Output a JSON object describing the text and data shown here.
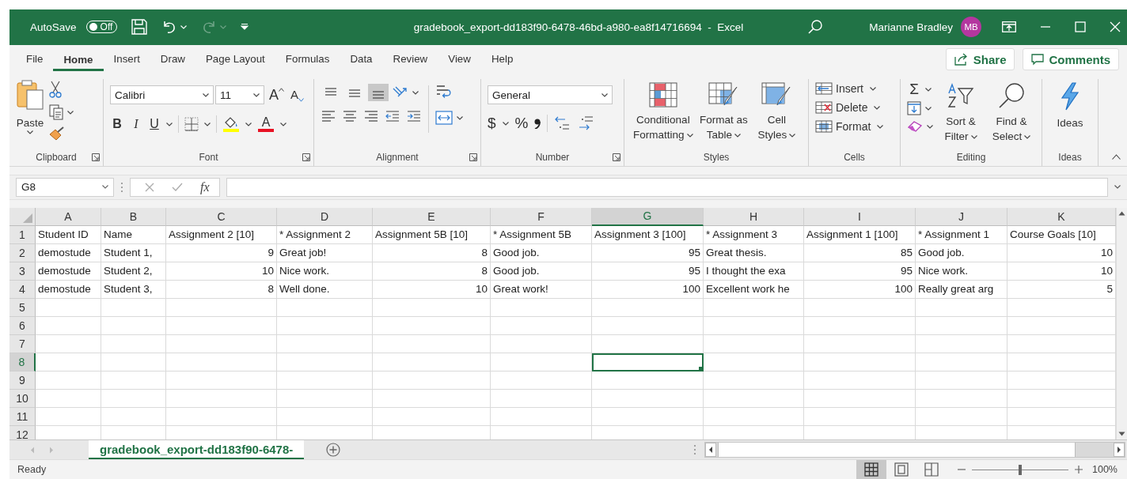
{
  "title_bar": {
    "autosave_label": "AutoSave",
    "autosave_toggle": {
      "label": "Off",
      "on": false
    },
    "quick_access": [
      {
        "kind": "save",
        "disabled": false
      },
      {
        "kind": "undo",
        "disabled": false
      },
      {
        "kind": "redo",
        "disabled": true
      },
      {
        "kind": "customize",
        "disabled": false
      }
    ],
    "title": "gradebook_export-dd183f90-6478-46bd-a980-ea8f14716694  -  Excel",
    "user_name": "Marianne Bradley",
    "avatar_initials": "MB"
  },
  "menu_tabs": [
    {
      "label": "File",
      "selected": false
    },
    {
      "label": "Home",
      "selected": true
    },
    {
      "label": "Insert",
      "selected": false
    },
    {
      "label": "Draw",
      "selected": false
    },
    {
      "label": "Page Layout",
      "selected": false
    },
    {
      "label": "Formulas",
      "selected": false
    },
    {
      "label": "Data",
      "selected": false
    },
    {
      "label": "Review",
      "selected": false
    },
    {
      "label": "View",
      "selected": false
    },
    {
      "label": "Help",
      "selected": false
    }
  ],
  "share_button": "Share",
  "comments_button": "Comments",
  "ribbon": {
    "clipboard": {
      "paste": "Paste",
      "group_label": "Clipboard"
    },
    "font": {
      "font_name": "Calibri",
      "font_size": "11",
      "grow": "A",
      "shrink": "A",
      "bold": "B",
      "italic": "I",
      "underline": "U",
      "font_color": "A",
      "group_label": "Font"
    },
    "alignment": {
      "vertical_align": [
        {
          "kind": "top",
          "selected": false
        },
        {
          "kind": "middle",
          "selected": false
        },
        {
          "kind": "bottom",
          "selected": true
        }
      ],
      "group_label": "Alignment"
    },
    "number": {
      "format": "General",
      "currency": "$",
      "percent": "%",
      "group_label": "Number"
    },
    "styles": {
      "buttons": [
        {
          "kind": "conditional",
          "label": "Conditional Formatting"
        },
        {
          "kind": "table",
          "label": "Format as Table"
        },
        {
          "kind": "cell",
          "label": "Cell Styles"
        }
      ],
      "group_label": "Styles"
    },
    "cells": {
      "buttons": [
        {
          "kind": "insert",
          "label": "Insert"
        },
        {
          "kind": "delete",
          "label": "Delete"
        },
        {
          "kind": "format",
          "label": "Format"
        }
      ],
      "group_label": "Cells"
    },
    "editing": {
      "autosum": "Σ",
      "sort_filter": "Sort & Filter",
      "find_select": "Find & Select",
      "group_label": "Editing"
    },
    "ideas": {
      "button": "Ideas",
      "group_label": "Ideas"
    }
  },
  "formula_bar": {
    "name_box": "G8",
    "function_label": "fx"
  },
  "sheet": {
    "columns": [
      {
        "label": "A",
        "kind": "text",
        "selected": false
      },
      {
        "label": "B",
        "kind": "text",
        "selected": false
      },
      {
        "label": "C",
        "kind": "number",
        "selected": false
      },
      {
        "label": "D",
        "kind": "text",
        "selected": false
      },
      {
        "label": "E",
        "kind": "number",
        "selected": false
      },
      {
        "label": "F",
        "kind": "text",
        "selected": false
      },
      {
        "label": "G",
        "kind": "number",
        "selected": true
      },
      {
        "label": "H",
        "kind": "text",
        "selected": false
      },
      {
        "label": "I",
        "kind": "number",
        "selected": false
      },
      {
        "label": "J",
        "kind": "text",
        "selected": false
      },
      {
        "label": "K",
        "kind": "number",
        "selected": false
      }
    ],
    "rows": [
      {
        "number": "1",
        "kind": "header",
        "selected": false,
        "cells": [
          "Student ID",
          "Name",
          "Assignment 2 [10]",
          "* Assignment 2",
          "Assignment 5B [10]",
          "* Assignment 5B",
          "Assignment 3 [100]",
          "* Assignment 3",
          "Assignment 1 [100]",
          "* Assignment 1",
          "Course Goals [10]"
        ]
      },
      {
        "number": "2",
        "kind": "data",
        "selected": false,
        "cells": [
          "demostude",
          "Student 1,",
          "9",
          "Great job!",
          "8",
          "Good job.",
          "95",
          "Great thesis.",
          "85",
          "Good job.",
          "10"
        ]
      },
      {
        "number": "3",
        "kind": "data",
        "selected": false,
        "cells": [
          "demostude",
          "Student 2,",
          "10",
          "Nice work.",
          "8",
          "Good job.",
          "95",
          "I thought the exa",
          "95",
          "Nice work.",
          "10"
        ]
      },
      {
        "number": "4",
        "kind": "data",
        "selected": false,
        "cells": [
          "demostude",
          "Student 3,",
          "8",
          "Well done.",
          "10",
          "Great work!",
          "100",
          "Excellent work he",
          "100",
          "Really great arg",
          "5"
        ]
      },
      {
        "number": "5",
        "kind": "empty",
        "selected": false
      },
      {
        "number": "6",
        "kind": "empty",
        "selected": false
      },
      {
        "number": "7",
        "kind": "empty",
        "selected": false
      },
      {
        "number": "8",
        "kind": "empty",
        "selected": true
      },
      {
        "number": "9",
        "kind": "empty",
        "selected": false
      },
      {
        "number": "10",
        "kind": "empty",
        "selected": false
      },
      {
        "number": "11",
        "kind": "empty",
        "selected": false
      },
      {
        "number": "12",
        "kind": "empty",
        "selected": false
      }
    ]
  },
  "sheet_tabs": [
    {
      "label": "gradebook_export-dd183f90-6478-",
      "selected": true
    }
  ],
  "status_bar": {
    "status": "Ready",
    "views": [
      {
        "kind": "normal",
        "selected": true
      },
      {
        "kind": "page_layout",
        "selected": false
      },
      {
        "kind": "page_break",
        "selected": false
      }
    ],
    "zoom": {
      "level": 0.5,
      "label": "100%"
    }
  }
}
